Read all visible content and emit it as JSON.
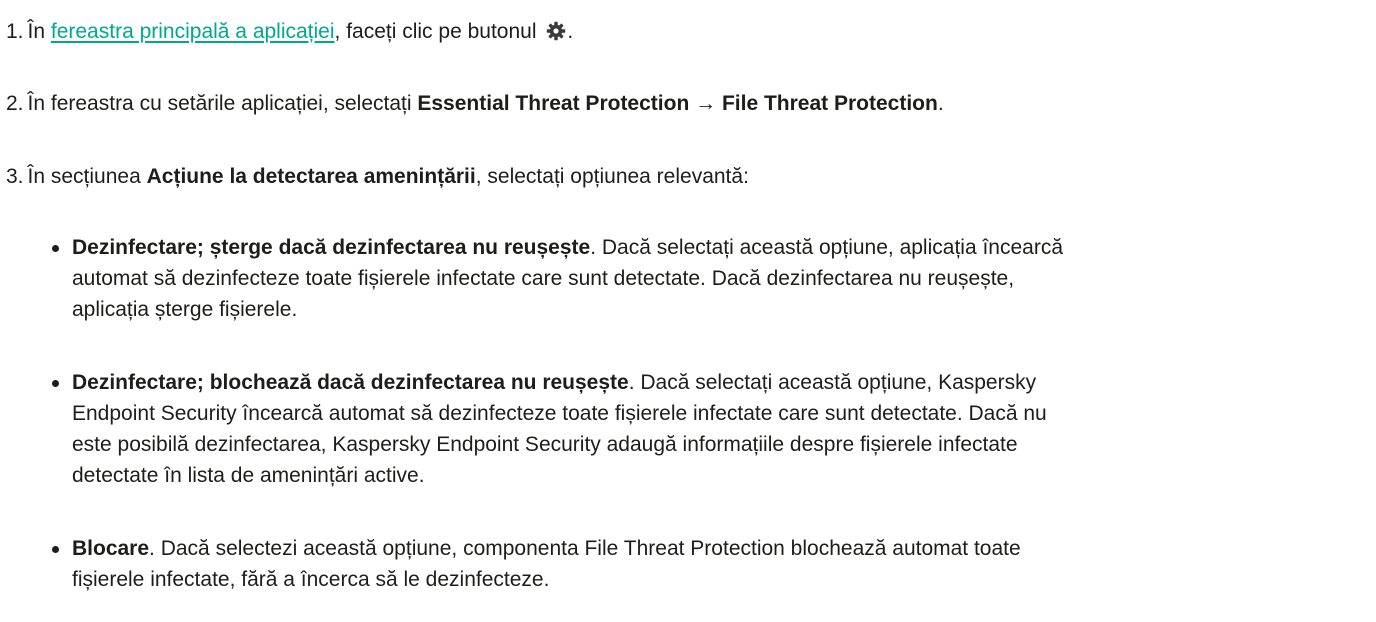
{
  "steps": [
    {
      "number": "1.",
      "before": "În ",
      "link": "fereastra principală a aplicației",
      "after": ", faceți clic pe butonul ",
      "icon": "gear-icon",
      "end": "."
    },
    {
      "number": "2.",
      "before": "În fereastra cu setările aplicației, selectați ",
      "bold": "Essential Threat Protection → File Threat Protection",
      "end": "."
    },
    {
      "number": "3.",
      "before": "În secțiunea ",
      "bold": "Acțiune la detectarea amenințării",
      "after": ", selectați opțiunea relevantă:"
    }
  ],
  "options": [
    {
      "bold": "Dezinfectare; șterge dacă dezinfectarea nu reușește",
      "line1": ". Dacă selectați această opțiune, aplicația încearcă",
      "line2": "automat să dezinfecteze toate fișierele infectate care sunt detectate. Dacă dezinfectarea nu reușește,",
      "line3": "aplicația șterge fișierele."
    },
    {
      "bold": "Dezinfectare; blochează dacă dezinfectarea nu reușește",
      "line1": ". Dacă selectați această opțiune, Kaspersky",
      "line2": "Endpoint Security încearcă automat să dezinfecteze toate fișierele infectate care sunt detectate. Dacă nu",
      "line3": "este posibilă dezinfectarea, Kaspersky Endpoint Security adaugă informațiile despre fișierele infectate",
      "line4": "detectate în lista de amenințări active."
    },
    {
      "bold": "Blocare",
      "line1": ". Dacă selectezi această opțiune, componenta File Threat Protection blochează automat toate",
      "line2": "fișierele infectate, fără a încerca să le dezinfecteze."
    }
  ],
  "colors": {
    "link": "#00a88e",
    "text": "#1d1d1b"
  }
}
